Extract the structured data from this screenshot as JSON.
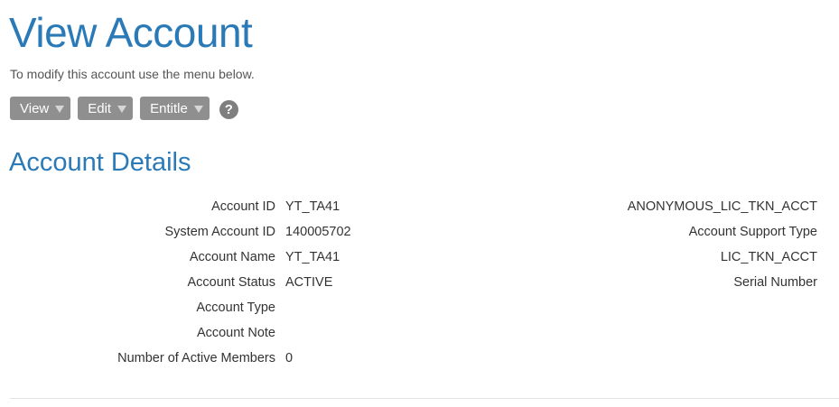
{
  "header": {
    "title": "View Account",
    "subtitle": "To modify this account use the menu below."
  },
  "toolbar": {
    "view_label": "View",
    "edit_label": "Edit",
    "entitle_label": "Entitle",
    "help_symbol": "?"
  },
  "section": {
    "title": "Account Details"
  },
  "details": [
    {
      "label": "Account ID",
      "value": "YT_TA41"
    },
    {
      "label": "System Account ID",
      "value": "140005702"
    },
    {
      "label": "Account Name",
      "value": "YT_TA41"
    },
    {
      "label": "Account Status",
      "value": "ACTIVE"
    },
    {
      "label": "Account Type",
      "value": ""
    },
    {
      "label": "Account Note",
      "value": ""
    },
    {
      "label": "Number of Active Members",
      "value": "0"
    }
  ],
  "right_details": [
    "ANONYMOUS_LIC_TKN_ACCT",
    "Account Support Type",
    "LIC_TKN_ACCT",
    "Serial Number"
  ],
  "colors": {
    "accent": "#2a7ab8",
    "button_bg": "#8f8f8f",
    "help_bg": "#7f7f7f"
  }
}
